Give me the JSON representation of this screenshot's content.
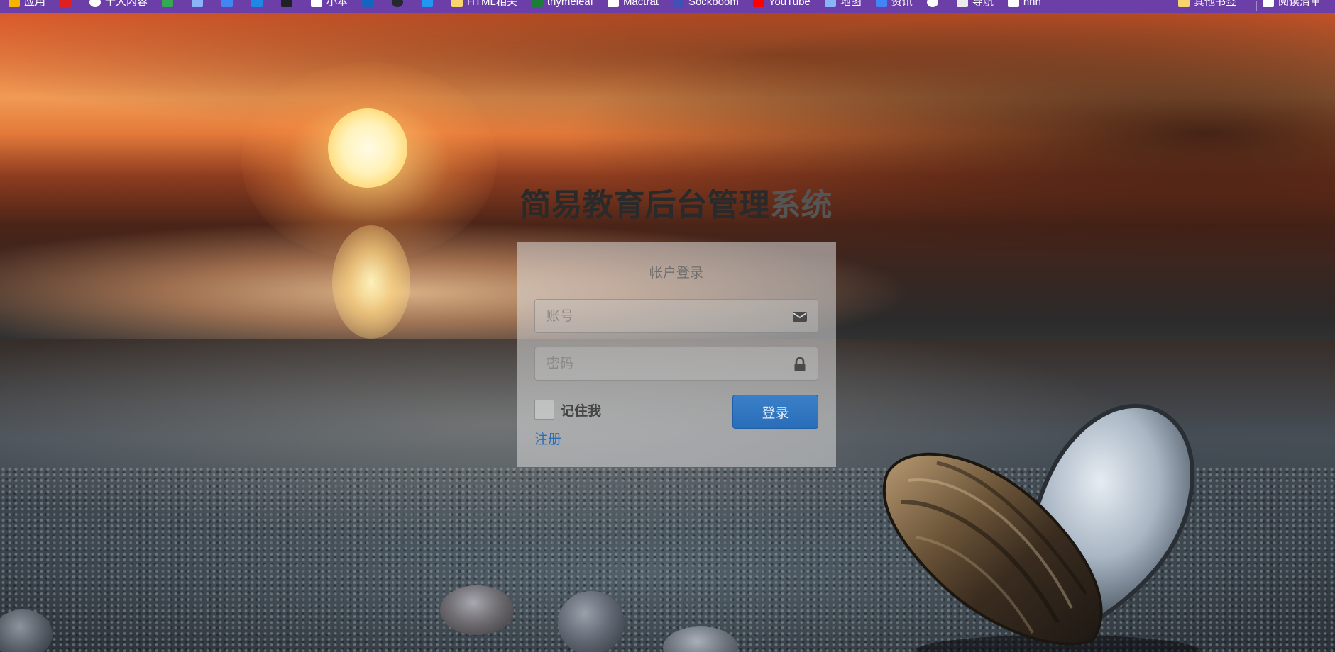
{
  "bookmarks_bar": {
    "items": [
      {
        "label": "应用",
        "icon": "apps-grid-icon",
        "color": "#f4b400"
      },
      {
        "label": "",
        "icon": "video-icon",
        "color": "#e02020"
      },
      {
        "label": "千人内容",
        "icon": "bookmark-icon",
        "color": "#ffffff"
      },
      {
        "label": "",
        "icon": "site-icon",
        "color": "#34a853"
      },
      {
        "label": "",
        "icon": "star-icon",
        "color": "#8ab4f8"
      },
      {
        "label": "",
        "icon": "site-icon",
        "color": "#4285f4"
      },
      {
        "label": "",
        "icon": "site-icon",
        "color": "#1e88e5"
      },
      {
        "label": "",
        "icon": "site-icon",
        "color": "#202124"
      },
      {
        "label": "小本",
        "icon": "site-icon",
        "color": "#ffffff"
      },
      {
        "label": "",
        "icon": "site-icon",
        "color": "#1565c0"
      },
      {
        "label": "",
        "icon": "github-icon",
        "color": "#24292e"
      },
      {
        "label": "",
        "icon": "site-icon",
        "color": "#2196f3"
      },
      {
        "label": "HTML相关",
        "icon": "folder-icon",
        "color": "#f9d56e"
      },
      {
        "label": "thymeleaf",
        "icon": "site-icon",
        "color": "#1b7d38"
      },
      {
        "label": "Mactrat",
        "icon": "site-icon",
        "color": "#ffffff"
      },
      {
        "label": "Sockboom",
        "icon": "site-icon",
        "color": "#3f51b5"
      },
      {
        "label": "YouTube",
        "icon": "youtube-icon",
        "color": "#ff0000"
      },
      {
        "label": "地图",
        "icon": "map-icon",
        "color": "#8ab4f8"
      },
      {
        "label": "资讯",
        "icon": "site-icon",
        "color": "#4285f4"
      },
      {
        "label": "",
        "icon": "site-icon",
        "color": "#ffffff"
      },
      {
        "label": "导航",
        "icon": "site-icon",
        "color": "#e8eaed"
      },
      {
        "label": "hhh",
        "icon": "site-icon",
        "color": "#ffffff"
      }
    ],
    "right_items": [
      {
        "label": "其他书签",
        "icon": "folder-icon",
        "color": "#f9d56e"
      },
      {
        "label": "阅读清单",
        "icon": "reading-list-icon",
        "color": "#ffffff"
      }
    ]
  },
  "page": {
    "title_main": "简易教育后台管理",
    "title_tail": "系统"
  },
  "login": {
    "heading": "帐户登录",
    "account_placeholder": "账号",
    "account_value": "",
    "account_icon": "envelope-icon",
    "password_placeholder": "密码",
    "password_value": "",
    "password_icon": "lock-icon",
    "remember_label": "记住我",
    "remember_checked": false,
    "submit_label": "登录",
    "register_label": "注册"
  },
  "colors": {
    "bookmarks_bar": "#6c3fa8",
    "primary_button": "#2a6db8",
    "link": "#2a6db8"
  }
}
